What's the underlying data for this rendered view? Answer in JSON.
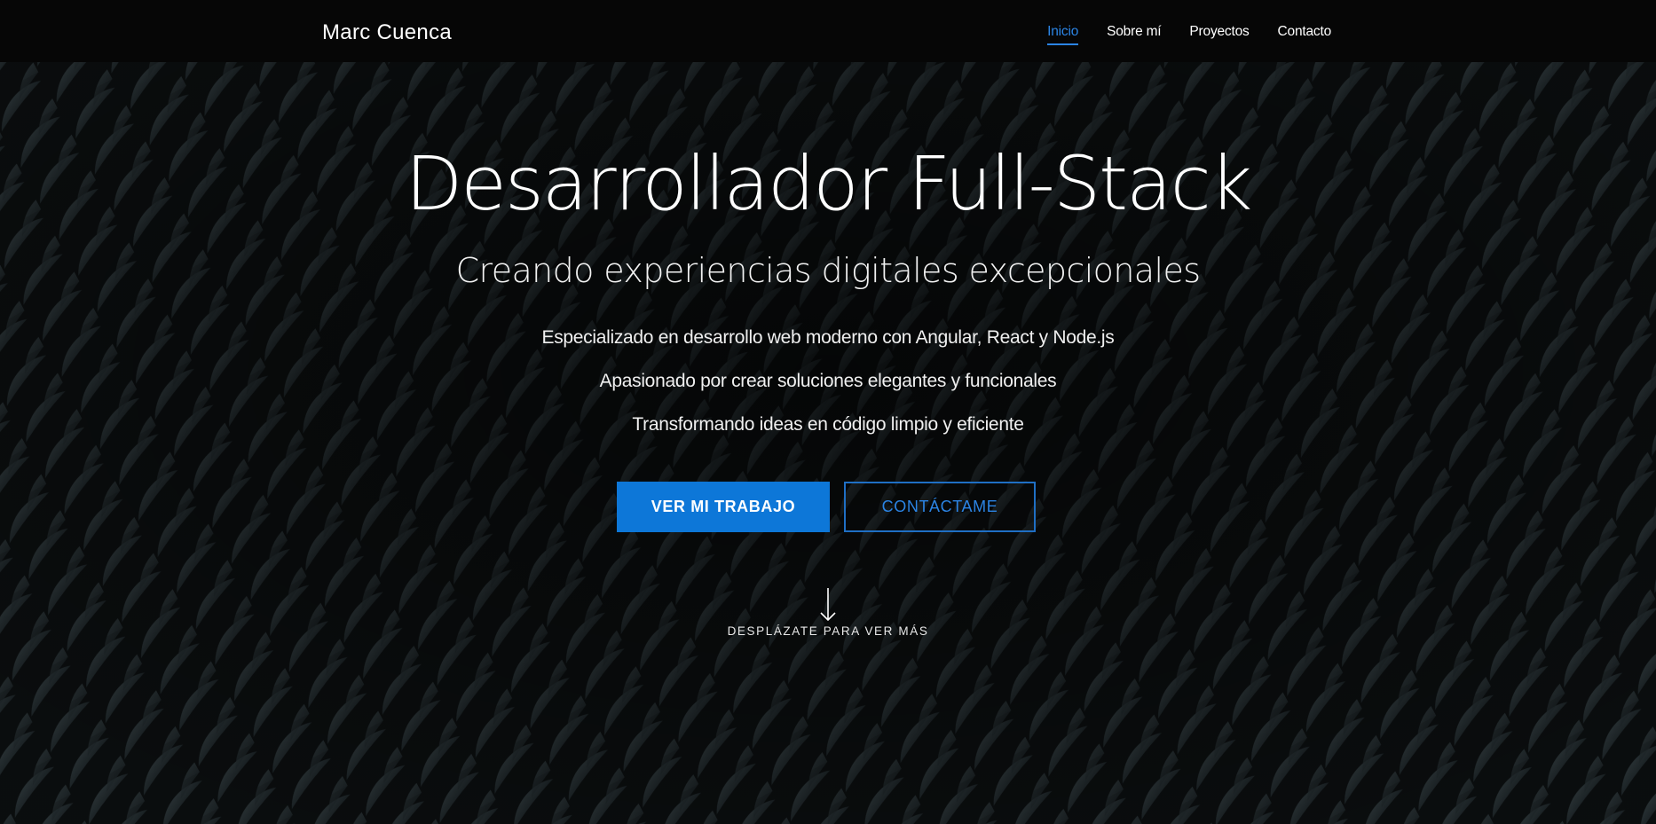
{
  "navbar": {
    "brand": "Marc Cuenca",
    "links": [
      {
        "label": "Inicio",
        "active": true
      },
      {
        "label": "Sobre mí",
        "active": false
      },
      {
        "label": "Proyectos",
        "active": false
      },
      {
        "label": "Contacto",
        "active": false
      }
    ]
  },
  "hero": {
    "title": "Desarrollador Full-Stack",
    "subtitle": "Creando experiencias digitales excepcionales",
    "lines": [
      "Especializado en desarrollo web moderno con Angular, React y Node.js",
      "Apasionado por crear soluciones elegantes y funcionales",
      "Transformando ideas en código limpio y eficiente"
    ],
    "primary_button": "VER MI TRABAJO",
    "secondary_button": "CONTÁCTAME",
    "scroll_hint": "DESPLÁZATE PARA VER MÁS",
    "scroll_icon": "arrow-down-icon"
  },
  "colors": {
    "accent": "#0d77d8",
    "accent_text": "#2b84e4",
    "navbar_bg": "#060606",
    "background": "#0a0c0d"
  }
}
